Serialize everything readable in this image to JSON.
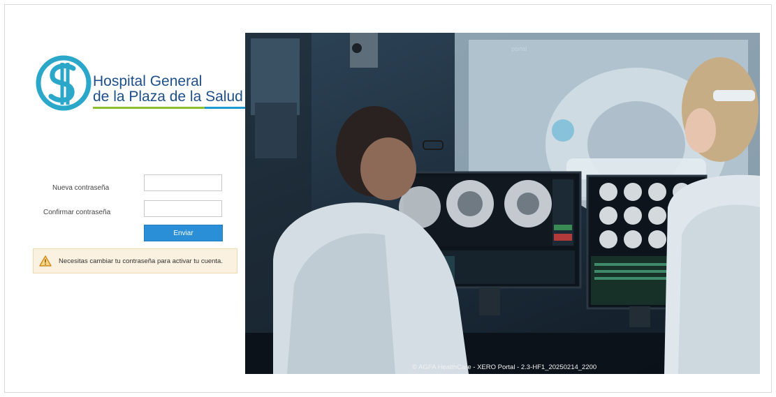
{
  "brand": {
    "line1": "Hospital General",
    "line2": "de la Plaza de la Salud",
    "colors": {
      "primary": "#1c4f8a",
      "teal": "#2aa7c9",
      "green": "#8dbf2e",
      "blue": "#1c9ad6"
    }
  },
  "form": {
    "new_password_label": "Nueva contraseña",
    "confirm_password_label": "Confirmar contraseña",
    "new_password_value": "",
    "confirm_password_value": "",
    "submit_label": "Enviar",
    "accent": "#2a8fd6"
  },
  "alert": {
    "icon": "warning-triangle-icon",
    "message": "Necesitas cambiar tu contraseña para activar tu cuenta."
  },
  "hero": {
    "portal_caption": "portal",
    "footer": "© AGFA HealthCare - XERO Portal - 2.3-HF1_20250214_2200"
  }
}
